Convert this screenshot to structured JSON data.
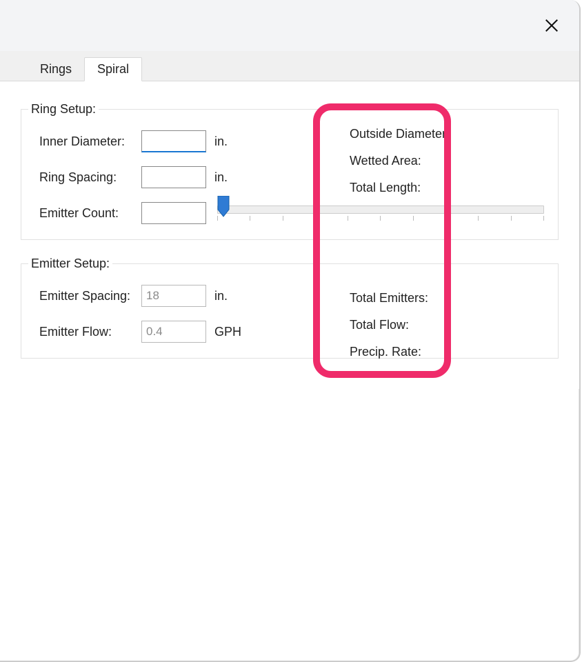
{
  "tabs": {
    "rings": "Rings",
    "spiral": "Spiral",
    "active": "spiral"
  },
  "ring_setup": {
    "legend": "Ring Setup:",
    "inner_diameter": {
      "label": "Inner Diameter:",
      "value": "",
      "unit": "in."
    },
    "ring_spacing": {
      "label": "Ring Spacing:",
      "value": "",
      "unit": "in."
    },
    "emitter_count": {
      "label": "Emitter Count:",
      "value": "",
      "unit": ""
    },
    "outputs": {
      "outside_diameter": "Outside Diameter:",
      "wetted_area": "Wetted Area:",
      "total_length": "Total Length:"
    }
  },
  "emitter_setup": {
    "legend": "Emitter Setup:",
    "emitter_spacing": {
      "label": "Emitter Spacing:",
      "value": "18",
      "unit": "in."
    },
    "emitter_flow": {
      "label": "Emitter Flow:",
      "value": "0.4",
      "unit": "GPH"
    },
    "outputs": {
      "total_emitters": "Total Emitters:",
      "total_flow": "Total Flow:",
      "precip_rate": "Precip. Rate:"
    }
  }
}
